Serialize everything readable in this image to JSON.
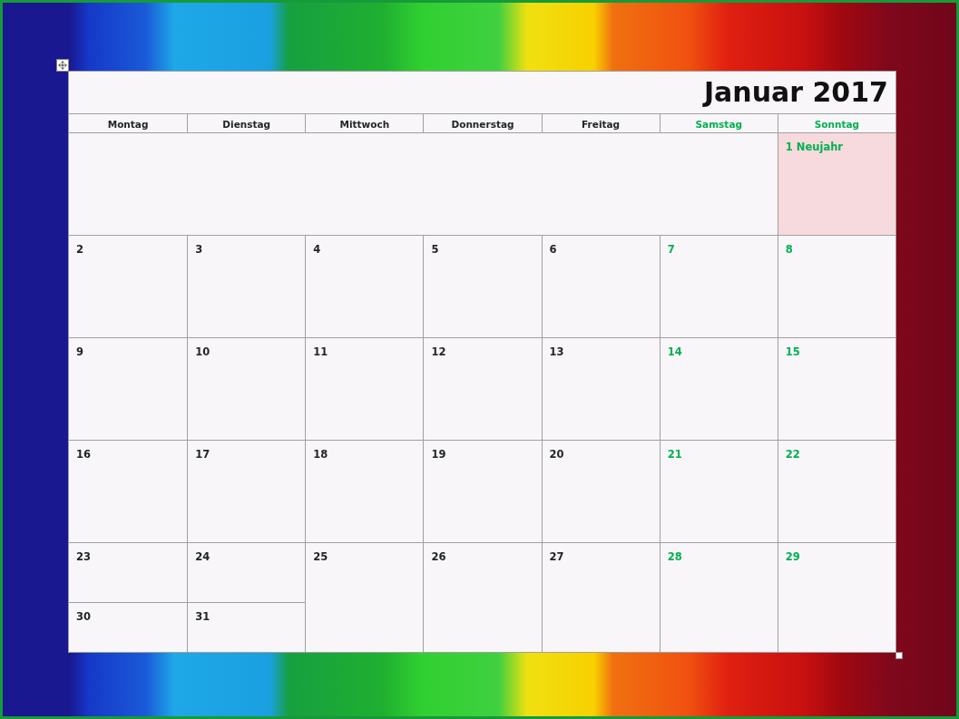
{
  "title": "Januar 2017",
  "weekdays": [
    {
      "label": "Montag",
      "weekend": false
    },
    {
      "label": "Dienstag",
      "weekend": false
    },
    {
      "label": "Mittwoch",
      "weekend": false
    },
    {
      "label": "Donnerstag",
      "weekend": false
    },
    {
      "label": "Freitag",
      "weekend": false
    },
    {
      "label": "Samstag",
      "weekend": true
    },
    {
      "label": "Sonntag",
      "weekend": true
    }
  ],
  "weeks": [
    {
      "days": [
        {
          "kind": "blank"
        },
        {
          "kind": "blank"
        },
        {
          "kind": "blank"
        },
        {
          "kind": "blank"
        },
        {
          "kind": "blank"
        },
        {
          "kind": "blank"
        },
        {
          "kind": "day",
          "number": "1 Neujahr",
          "weekend": true,
          "holiday": true
        }
      ]
    },
    {
      "days": [
        {
          "kind": "day",
          "number": "2",
          "weekend": false,
          "holiday": false
        },
        {
          "kind": "day",
          "number": "3",
          "weekend": false,
          "holiday": false
        },
        {
          "kind": "day",
          "number": "4",
          "weekend": false,
          "holiday": false
        },
        {
          "kind": "day",
          "number": "5",
          "weekend": false,
          "holiday": false
        },
        {
          "kind": "day",
          "number": "6",
          "weekend": false,
          "holiday": false
        },
        {
          "kind": "day",
          "number": "7",
          "weekend": true,
          "holiday": false
        },
        {
          "kind": "day",
          "number": "8",
          "weekend": true,
          "holiday": false
        }
      ]
    },
    {
      "days": [
        {
          "kind": "day",
          "number": "9",
          "weekend": false,
          "holiday": false
        },
        {
          "kind": "day",
          "number": "10",
          "weekend": false,
          "holiday": false
        },
        {
          "kind": "day",
          "number": "11",
          "weekend": false,
          "holiday": false
        },
        {
          "kind": "day",
          "number": "12",
          "weekend": false,
          "holiday": false
        },
        {
          "kind": "day",
          "number": "13",
          "weekend": false,
          "holiday": false
        },
        {
          "kind": "day",
          "number": "14",
          "weekend": true,
          "holiday": false
        },
        {
          "kind": "day",
          "number": "15",
          "weekend": true,
          "holiday": false
        }
      ]
    },
    {
      "days": [
        {
          "kind": "day",
          "number": "16",
          "weekend": false,
          "holiday": false
        },
        {
          "kind": "day",
          "number": "17",
          "weekend": false,
          "holiday": false
        },
        {
          "kind": "day",
          "number": "18",
          "weekend": false,
          "holiday": false
        },
        {
          "kind": "day",
          "number": "19",
          "weekend": false,
          "holiday": false
        },
        {
          "kind": "day",
          "number": "20",
          "weekend": false,
          "holiday": false
        },
        {
          "kind": "day",
          "number": "21",
          "weekend": true,
          "holiday": false
        },
        {
          "kind": "day",
          "number": "22",
          "weekend": true,
          "holiday": false
        }
      ]
    },
    {
      "days": [
        {
          "kind": "split",
          "number": "23",
          "lower": "30",
          "weekend": false,
          "holiday": false
        },
        {
          "kind": "split",
          "number": "24",
          "lower": "31",
          "weekend": false,
          "holiday": false
        },
        {
          "kind": "day",
          "number": "25",
          "weekend": false,
          "holiday": false
        },
        {
          "kind": "day",
          "number": "26",
          "weekend": false,
          "holiday": false
        },
        {
          "kind": "day",
          "number": "27",
          "weekend": false,
          "holiday": false
        },
        {
          "kind": "day",
          "number": "28",
          "weekend": true,
          "holiday": false
        },
        {
          "kind": "day",
          "number": "29",
          "weekend": true,
          "holiday": false
        }
      ]
    }
  ]
}
